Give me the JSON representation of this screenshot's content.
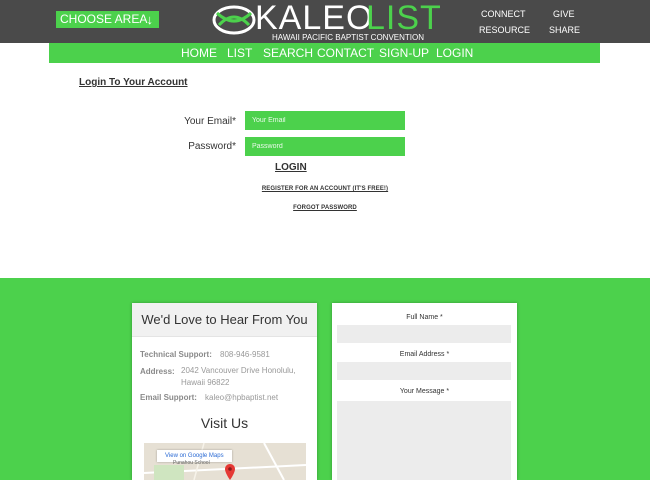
{
  "colors": {
    "header_bg": "#4a4a4a",
    "accent_green": "#4cd14c",
    "text": "#333333",
    "muted": "#999999"
  },
  "header": {
    "choose_area": "CHOOSE AREA",
    "choose_arrow": "↓",
    "logo_kaleo": "KALEO",
    "logo_list": "LIST",
    "logo_tagline": "HAWAII PACIFIC BAPTIST CONVENTION",
    "links": {
      "connect": "CONNECT",
      "give": "GIVE",
      "resource": "RESOURCE",
      "share": "SHARE"
    }
  },
  "nav": {
    "home": "HOME",
    "list": "LIST",
    "search": "SEARCH",
    "contact": "CONTACT",
    "signup": "SIGN-UP",
    "login": "LOGIN"
  },
  "login": {
    "title": "Login To Your Account",
    "email_label": "Your Email*",
    "email_placeholder": "Your Email",
    "password_label": "Password*",
    "password_placeholder": "Password",
    "login_button": "LOGIN",
    "register_link": "REGISTER FOR AN ACCOUNT (IT'S FREE!)",
    "forgot_link": "FORGOT PASSWORD"
  },
  "contact": {
    "heading": "We'd Love to Hear From You",
    "tech_label": "Technical Support:",
    "tech_value": "808-946-9581",
    "address_label": "Address:",
    "address_line1": "2042 Vancouver Drive Honolulu,",
    "address_line2": "Hawaii 96822",
    "email_label": "Email Support:",
    "email_value": "kaleo@hpbaptist.net",
    "visit_title": "Visit Us",
    "map_button": "View on Google Maps",
    "map_place": "Punahou School"
  },
  "form": {
    "full_name_label": "Full Name *",
    "email_label": "Email Address *",
    "message_label": "Your Message *"
  }
}
